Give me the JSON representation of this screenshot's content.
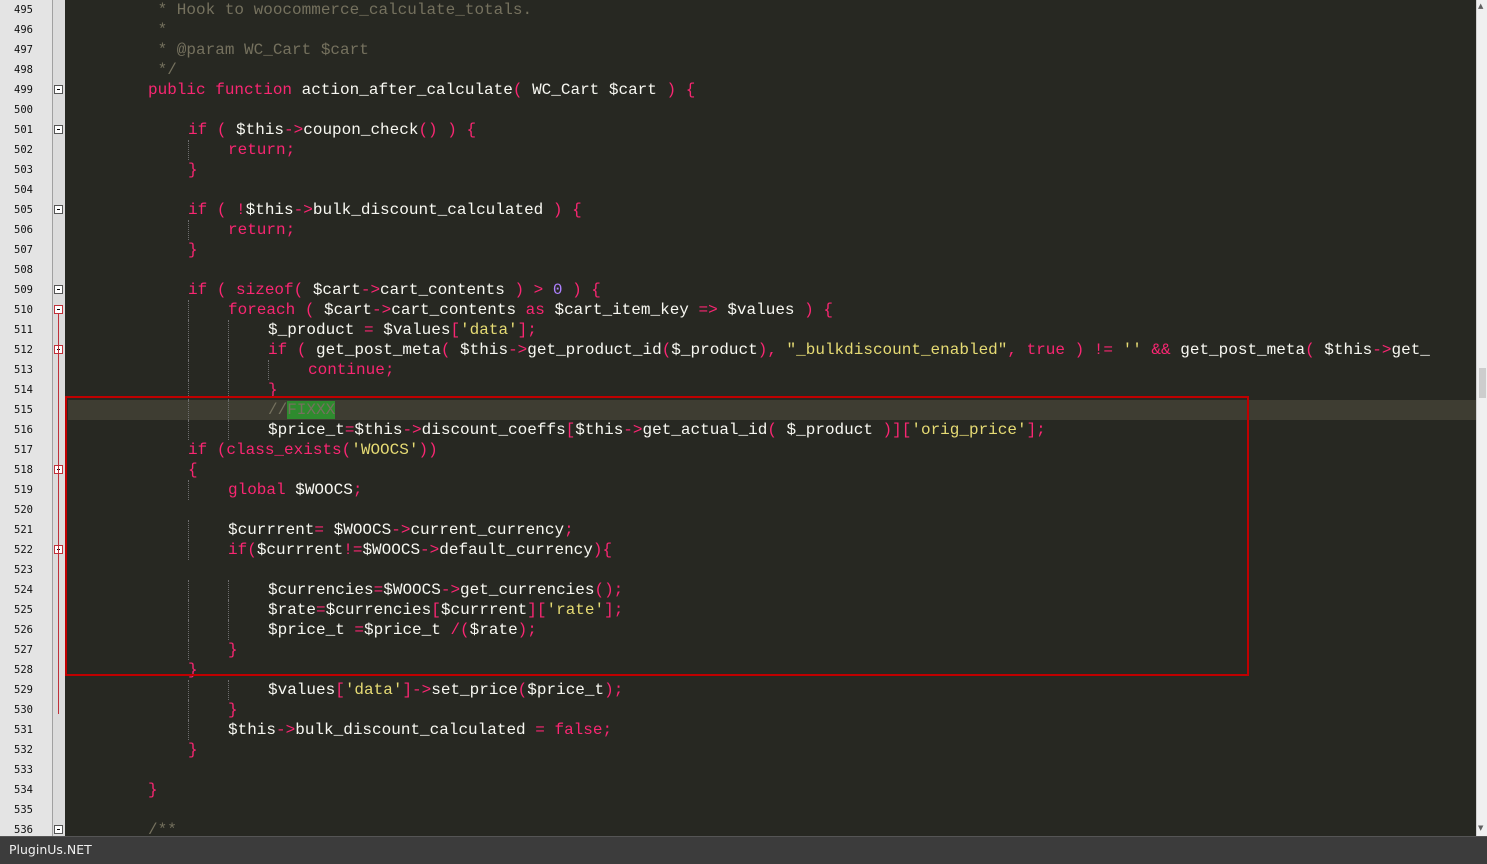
{
  "editor": {
    "language": "php",
    "active_line": 515,
    "colors": {
      "background": "#272822",
      "active_line": "#3e3d32",
      "comment": "#75715e",
      "keyword": "#f92672",
      "string": "#e6db74",
      "number": "#ae81ff",
      "identifier": "#f8f8f2",
      "highlight_box": "#c00000",
      "search_match": "#2e8b2e"
    },
    "lines": [
      {
        "n": "495",
        "indent": 2,
        "fold": "",
        "tokens": [
          [
            "c-cmt",
            " * Hook to woocommerce_calculate_totals."
          ]
        ]
      },
      {
        "n": "496",
        "indent": 2,
        "fold": "",
        "tokens": [
          [
            "c-cmt",
            " *"
          ]
        ]
      },
      {
        "n": "497",
        "indent": 2,
        "fold": "",
        "tokens": [
          [
            "c-cmt",
            " * @param WC_Cart $cart"
          ]
        ]
      },
      {
        "n": "498",
        "indent": 2,
        "fold": "",
        "tokens": [
          [
            "c-cmt",
            " */"
          ]
        ]
      },
      {
        "n": "499",
        "indent": 2,
        "fold": "dark",
        "tokens": [
          [
            "c-kw",
            "public function "
          ],
          [
            "c-id",
            "action_after_calculate"
          ],
          [
            "c-op",
            "( "
          ],
          [
            "c-id",
            "WC_Cart $cart "
          ],
          [
            "c-op",
            ") {"
          ]
        ]
      },
      {
        "n": "500",
        "indent": 0,
        "fold": "",
        "tokens": []
      },
      {
        "n": "501",
        "indent": 3,
        "fold": "dark",
        "tokens": [
          [
            "c-kw",
            "if "
          ],
          [
            "c-op",
            "( "
          ],
          [
            "c-id",
            "$this"
          ],
          [
            "c-op",
            "->"
          ],
          [
            "c-id",
            "coupon_check"
          ],
          [
            "c-op",
            "() ) {"
          ]
        ]
      },
      {
        "n": "502",
        "indent": 4,
        "fold": "",
        "tokens": [
          [
            "c-kw",
            "return;"
          ]
        ]
      },
      {
        "n": "503",
        "indent": 3,
        "fold": "",
        "tokens": [
          [
            "c-op",
            "}"
          ]
        ]
      },
      {
        "n": "504",
        "indent": 0,
        "fold": "",
        "tokens": []
      },
      {
        "n": "505",
        "indent": 3,
        "fold": "dark",
        "tokens": [
          [
            "c-kw",
            "if "
          ],
          [
            "c-op",
            "( !"
          ],
          [
            "c-id",
            "$this"
          ],
          [
            "c-op",
            "->"
          ],
          [
            "c-id",
            "bulk_discount_calculated "
          ],
          [
            "c-op",
            ") {"
          ]
        ]
      },
      {
        "n": "506",
        "indent": 4,
        "fold": "",
        "tokens": [
          [
            "c-kw",
            "return;"
          ]
        ]
      },
      {
        "n": "507",
        "indent": 3,
        "fold": "",
        "tokens": [
          [
            "c-op",
            "}"
          ]
        ]
      },
      {
        "n": "508",
        "indent": 0,
        "fold": "",
        "tokens": []
      },
      {
        "n": "509",
        "indent": 3,
        "fold": "dark",
        "tokens": [
          [
            "c-kw",
            "if "
          ],
          [
            "c-op",
            "( "
          ],
          [
            "c-kw",
            "sizeof"
          ],
          [
            "c-op",
            "( "
          ],
          [
            "c-id",
            "$cart"
          ],
          [
            "c-op",
            "->"
          ],
          [
            "c-id",
            "cart_contents "
          ],
          [
            "c-op",
            ") > "
          ],
          [
            "c-num",
            "0"
          ],
          [
            "c-op",
            " ) {"
          ]
        ]
      },
      {
        "n": "510",
        "indent": 4,
        "fold": "red",
        "tokens": [
          [
            "c-kw",
            "foreach "
          ],
          [
            "c-op",
            "( "
          ],
          [
            "c-id",
            "$cart"
          ],
          [
            "c-op",
            "->"
          ],
          [
            "c-id",
            "cart_contents "
          ],
          [
            "c-kw",
            "as "
          ],
          [
            "c-id",
            "$cart_item_key "
          ],
          [
            "c-op",
            "=> "
          ],
          [
            "c-id",
            "$values "
          ],
          [
            "c-op",
            ") {"
          ]
        ]
      },
      {
        "n": "511",
        "indent": 5,
        "fold": "",
        "tokens": [
          [
            "c-id",
            "$_product "
          ],
          [
            "c-op",
            "= "
          ],
          [
            "c-id",
            "$values"
          ],
          [
            "c-op",
            "["
          ],
          [
            "c-str",
            "'data'"
          ],
          [
            "c-op",
            "];"
          ]
        ]
      },
      {
        "n": "512",
        "indent": 5,
        "fold": "red",
        "tokens": [
          [
            "c-kw",
            "if "
          ],
          [
            "c-op",
            "( "
          ],
          [
            "c-id",
            "get_post_meta"
          ],
          [
            "c-op",
            "( "
          ],
          [
            "c-id",
            "$this"
          ],
          [
            "c-op",
            "->"
          ],
          [
            "c-id",
            "get_product_id"
          ],
          [
            "c-op",
            "("
          ],
          [
            "c-id",
            "$_product"
          ],
          [
            "c-op",
            "), "
          ],
          [
            "c-str",
            "\"_bulkdiscount_enabled\""
          ],
          [
            "c-op",
            ", "
          ],
          [
            "c-kw",
            "true "
          ],
          [
            "c-op",
            ") != "
          ],
          [
            "c-str",
            "'' "
          ],
          [
            "c-op",
            "&& "
          ],
          [
            "c-id",
            "get_post_meta"
          ],
          [
            "c-op",
            "( "
          ],
          [
            "c-id",
            "$this"
          ],
          [
            "c-op",
            "->"
          ],
          [
            "c-id",
            "get_"
          ]
        ]
      },
      {
        "n": "513",
        "indent": 6,
        "fold": "",
        "tokens": [
          [
            "c-kw",
            "continue;"
          ]
        ]
      },
      {
        "n": "514",
        "indent": 5,
        "fold": "",
        "tokens": [
          [
            "c-op",
            "}"
          ]
        ]
      },
      {
        "n": "515",
        "indent": 5,
        "fold": "",
        "tokens": [
          [
            "c-cmt",
            "//"
          ],
          [
            "c-hl",
            "FIXXX"
          ]
        ]
      },
      {
        "n": "516",
        "indent": 5,
        "fold": "",
        "tokens": [
          [
            "c-id",
            "$price_t"
          ],
          [
            "c-op",
            "="
          ],
          [
            "c-id",
            "$this"
          ],
          [
            "c-op",
            "->"
          ],
          [
            "c-id",
            "discount_coeffs"
          ],
          [
            "c-op",
            "["
          ],
          [
            "c-id",
            "$this"
          ],
          [
            "c-op",
            "->"
          ],
          [
            "c-id",
            "get_actual_id"
          ],
          [
            "c-op",
            "( "
          ],
          [
            "c-id",
            "$_product "
          ],
          [
            "c-op",
            ")]["
          ],
          [
            "c-str",
            "'orig_price'"
          ],
          [
            "c-op",
            "];"
          ]
        ]
      },
      {
        "n": "517",
        "indent": 3,
        "fold": "",
        "tokens": [
          [
            "c-kw",
            "if "
          ],
          [
            "c-op",
            "("
          ],
          [
            "c-kw",
            "class_exists"
          ],
          [
            "c-op",
            "("
          ],
          [
            "c-str",
            "'WOOCS'"
          ],
          [
            "c-op",
            "))"
          ]
        ]
      },
      {
        "n": "518",
        "indent": 3,
        "fold": "red",
        "tokens": [
          [
            "c-op",
            "{"
          ]
        ]
      },
      {
        "n": "519",
        "indent": 4,
        "fold": "",
        "tokens": [
          [
            "c-kw",
            "global "
          ],
          [
            "c-id",
            "$WOOCS"
          ],
          [
            "c-op",
            ";"
          ]
        ]
      },
      {
        "n": "520",
        "indent": 0,
        "fold": "",
        "tokens": []
      },
      {
        "n": "521",
        "indent": 4,
        "fold": "",
        "tokens": [
          [
            "c-id",
            "$currrent"
          ],
          [
            "c-op",
            "= "
          ],
          [
            "c-id",
            "$WOOCS"
          ],
          [
            "c-op",
            "->"
          ],
          [
            "c-id",
            "current_currency"
          ],
          [
            "c-op",
            ";"
          ]
        ]
      },
      {
        "n": "522",
        "indent": 4,
        "fold": "red",
        "tokens": [
          [
            "c-kw",
            "if"
          ],
          [
            "c-op",
            "("
          ],
          [
            "c-id",
            "$currrent"
          ],
          [
            "c-op",
            "!="
          ],
          [
            "c-id",
            "$WOOCS"
          ],
          [
            "c-op",
            "->"
          ],
          [
            "c-id",
            "default_currency"
          ],
          [
            "c-op",
            "){"
          ]
        ]
      },
      {
        "n": "523",
        "indent": 0,
        "fold": "",
        "tokens": []
      },
      {
        "n": "524",
        "indent": 5,
        "fold": "",
        "tokens": [
          [
            "c-id",
            "$currencies"
          ],
          [
            "c-op",
            "="
          ],
          [
            "c-id",
            "$WOOCS"
          ],
          [
            "c-op",
            "->"
          ],
          [
            "c-id",
            "get_currencies"
          ],
          [
            "c-op",
            "();"
          ]
        ]
      },
      {
        "n": "525",
        "indent": 5,
        "fold": "",
        "tokens": [
          [
            "c-id",
            "$rate"
          ],
          [
            "c-op",
            "="
          ],
          [
            "c-id",
            "$currencies"
          ],
          [
            "c-op",
            "["
          ],
          [
            "c-id",
            "$currrent"
          ],
          [
            "c-op",
            "]["
          ],
          [
            "c-str",
            "'rate'"
          ],
          [
            "c-op",
            "];"
          ]
        ]
      },
      {
        "n": "526",
        "indent": 5,
        "fold": "",
        "tokens": [
          [
            "c-id",
            "$price_t "
          ],
          [
            "c-op",
            "="
          ],
          [
            "c-id",
            "$price_t "
          ],
          [
            "c-op",
            "/("
          ],
          [
            "c-id",
            "$rate"
          ],
          [
            "c-op",
            ");"
          ]
        ]
      },
      {
        "n": "527",
        "indent": 4,
        "fold": "",
        "tokens": [
          [
            "c-op",
            "}"
          ]
        ]
      },
      {
        "n": "528",
        "indent": 3,
        "fold": "",
        "tokens": [
          [
            "c-op",
            "}"
          ]
        ]
      },
      {
        "n": "529",
        "indent": 5,
        "fold": "",
        "tokens": [
          [
            "c-id",
            "$values"
          ],
          [
            "c-op",
            "["
          ],
          [
            "c-str",
            "'data'"
          ],
          [
            "c-op",
            "]->"
          ],
          [
            "c-id",
            "set_price"
          ],
          [
            "c-op",
            "("
          ],
          [
            "c-id",
            "$price_t"
          ],
          [
            "c-op",
            ");"
          ]
        ]
      },
      {
        "n": "530",
        "indent": 4,
        "fold": "",
        "tokens": [
          [
            "c-op",
            "}"
          ]
        ]
      },
      {
        "n": "531",
        "indent": 4,
        "fold": "",
        "tokens": [
          [
            "c-id",
            "$this"
          ],
          [
            "c-op",
            "->"
          ],
          [
            "c-id",
            "bulk_discount_calculated "
          ],
          [
            "c-op",
            "= "
          ],
          [
            "c-kw",
            "false"
          ],
          [
            "c-op",
            ";"
          ]
        ]
      },
      {
        "n": "532",
        "indent": 3,
        "fold": "",
        "tokens": [
          [
            "c-op",
            "}"
          ]
        ]
      },
      {
        "n": "533",
        "indent": 0,
        "fold": "",
        "tokens": []
      },
      {
        "n": "534",
        "indent": 2,
        "fold": "",
        "tokens": [
          [
            "c-op",
            "}"
          ]
        ]
      },
      {
        "n": "535",
        "indent": 0,
        "fold": "",
        "tokens": []
      },
      {
        "n": "536",
        "indent": 2,
        "fold": "dark",
        "tokens": [
          [
            "c-cmt",
            "/**"
          ]
        ]
      }
    ]
  },
  "statusbar": {
    "label": "PluginUs.NET"
  }
}
